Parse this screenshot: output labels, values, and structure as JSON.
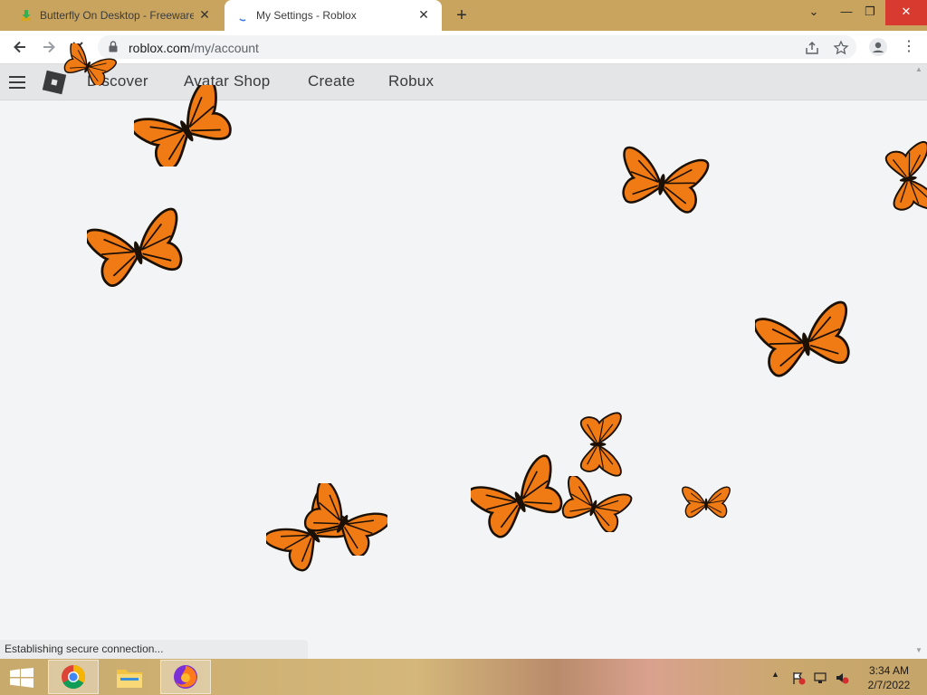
{
  "tabs": [
    {
      "title": "Butterfly On Desktop - Freeware",
      "active": false
    },
    {
      "title": "My Settings - Roblox",
      "active": true
    }
  ],
  "new_tab_label": "+",
  "window_controls": {
    "minimize": "—",
    "restore": "❐",
    "close": "✕",
    "tab_list": "⌄"
  },
  "address_bar": {
    "host": "roblox.com",
    "path": "/my/account"
  },
  "roblox_nav": [
    "Discover",
    "Avatar Shop",
    "Create",
    "Robux"
  ],
  "status_text": "Establishing secure connection...",
  "taskbar": {
    "apps": [
      "chrome",
      "file-explorer",
      "firefox"
    ],
    "clock_time": "3:34 AM",
    "clock_date": "2/7/2022",
    "tray_caret": "▲"
  },
  "colors": {
    "tab_strip": "#c9a45e",
    "butterfly_orange": "#f07a14",
    "butterfly_vein": "#1b1006"
  }
}
